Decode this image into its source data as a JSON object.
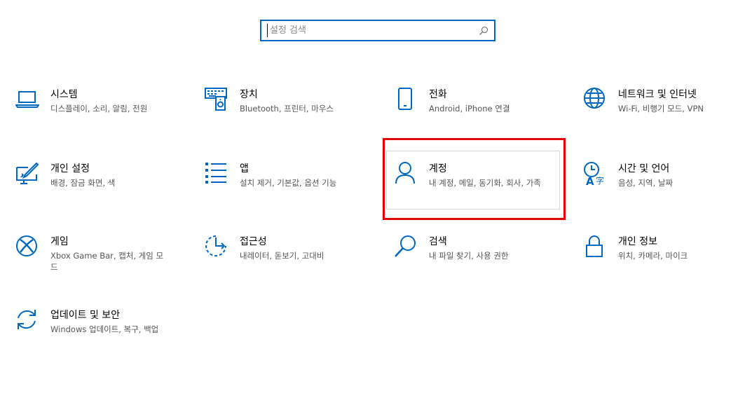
{
  "search": {
    "placeholder": "설정 검색",
    "icon": "search-icon"
  },
  "colors": {
    "accent": "#0067c0",
    "highlight": "#e50000"
  },
  "tiles": [
    {
      "title": "시스템",
      "desc": "디스플레이, 소리, 알림, 전원",
      "icon": "laptop-icon"
    },
    {
      "title": "장치",
      "desc": "Bluetooth, 프린터, 마우스",
      "icon": "devices-icon"
    },
    {
      "title": "전화",
      "desc": "Android, iPhone 연결",
      "icon": "phone-icon"
    },
    {
      "title": "네트워크 및 인터넷",
      "desc": "Wi-Fi, 비행기 모드, VPN",
      "icon": "globe-icon"
    },
    {
      "title": "개인 설정",
      "desc": "배경, 잠금 화면, 색",
      "icon": "personalization-icon"
    },
    {
      "title": "앱",
      "desc": "설치 제거, 기본값, 옵션 기능",
      "icon": "apps-list-icon"
    },
    {
      "title": "계정",
      "desc": "내 계정, 메일, 동기화, 회사, 가족",
      "icon": "person-icon"
    },
    {
      "title": "시간 및 언어",
      "desc": "음성, 지역, 날짜",
      "icon": "time-language-icon"
    },
    {
      "title": "게임",
      "desc": "Xbox Game Bar, 캡처, 게임 모드",
      "icon": "xbox-icon"
    },
    {
      "title": "접근성",
      "desc": "내레이터, 돋보기, 고대비",
      "icon": "accessibility-icon"
    },
    {
      "title": "검색",
      "desc": "내 파일 찾기, 사용 권한",
      "icon": "search-icon"
    },
    {
      "title": "개인 정보",
      "desc": "위치, 카메라, 마이크",
      "icon": "lock-icon"
    },
    {
      "title": "업데이트 및 보안",
      "desc": "Windows 업데이트, 복구, 백업",
      "icon": "update-icon"
    }
  ]
}
